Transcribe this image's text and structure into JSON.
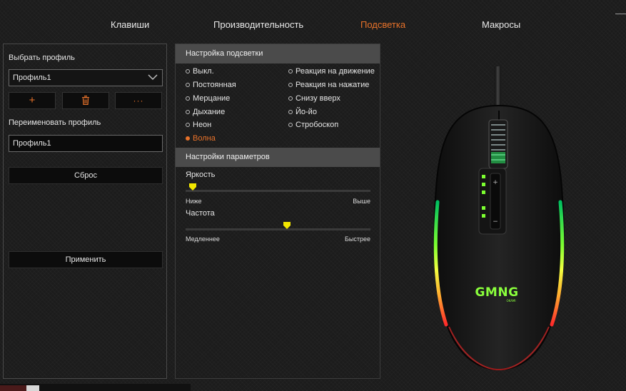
{
  "nav": {
    "tabs": [
      {
        "label": "Клавиши",
        "active": false
      },
      {
        "label": "Производительность",
        "active": false
      },
      {
        "label": "Подсветка",
        "active": true
      },
      {
        "label": "Макросы",
        "active": false
      }
    ]
  },
  "profile": {
    "select_label": "Выбрать профиль",
    "selected": "Профиль1",
    "buttons": {
      "add": "+",
      "delete_icon": "trash-icon",
      "more": "···"
    },
    "rename_label": "Переименовать профиль",
    "rename_value": "Профиль1",
    "reset_label": "Сброс",
    "apply_label": "Применить"
  },
  "lighting": {
    "header": "Настройка подсветки",
    "modes_left": [
      "Выкл.",
      "Постоянная",
      "Мерцание",
      "Дыхание",
      "Неон",
      "Волна"
    ],
    "modes_right": [
      "Реакция на движение",
      "Реакция на нажатие",
      "Снизу вверх",
      "Йо-йо",
      "Стробоскоп"
    ],
    "selected": "Волна"
  },
  "params": {
    "header": "Настройки параметров",
    "brightness": {
      "label": "Яркость",
      "min_label": "Ниже",
      "max_label": "Выше",
      "value": 0.02
    },
    "frequency": {
      "label": "Частота",
      "min_label": "Медленнее",
      "max_label": "Быстрее",
      "value": 0.55
    }
  },
  "device": {
    "brand": "GMNG",
    "model": "OKAMI"
  },
  "colors": {
    "accent": "#e8722a",
    "slider_thumb": "#f2e600"
  }
}
